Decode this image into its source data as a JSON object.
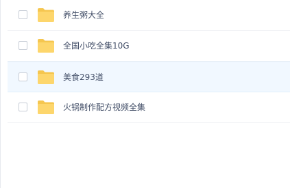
{
  "files": [
    {
      "name": "养生粥大全",
      "selected": false
    },
    {
      "name": "全国小吃全集10G",
      "selected": false
    },
    {
      "name": "美食293道",
      "selected": true
    },
    {
      "name": "火锅制作配方视频全集",
      "selected": false
    }
  ],
  "colors": {
    "folder": "#fdd66c",
    "folder_back": "#f5c64f",
    "selected_row": "#f1f8ff"
  },
  "icons": {
    "folder": "folder-icon",
    "checkbox": "checkbox-unchecked"
  }
}
